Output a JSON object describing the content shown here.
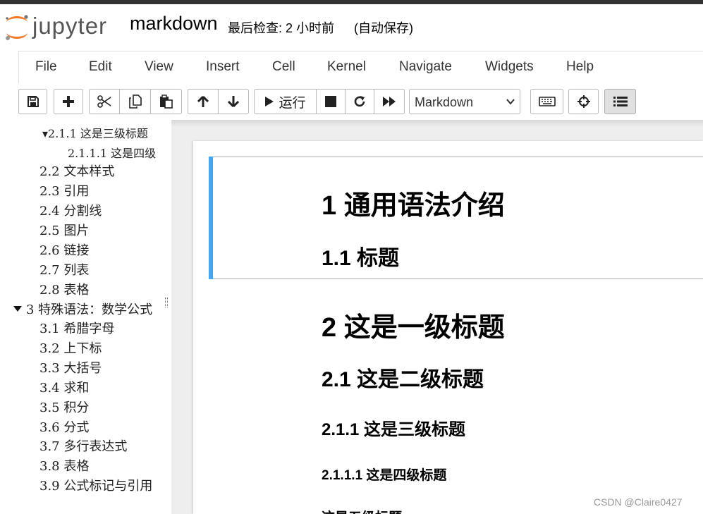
{
  "header": {
    "logo_text": "jupyter",
    "notebook_name": "markdown",
    "checkpoint": "最后检查: 2 小时前",
    "autosave": "(自动保存)"
  },
  "menubar": [
    "File",
    "Edit",
    "View",
    "Insert",
    "Cell",
    "Kernel",
    "Navigate",
    "Widgets",
    "Help"
  ],
  "toolbar": {
    "run_label": "运行",
    "cell_type": "Markdown"
  },
  "toc": [
    {
      "label": "▾2.1.1 这是三级标题"
    },
    {
      "label": "2.1.1.1 这是四级"
    },
    {
      "label": "2.2 文本样式"
    },
    {
      "label": "2.3 引用"
    },
    {
      "label": "2.4 分割线"
    },
    {
      "label": "2.5 图片"
    },
    {
      "label": "2.6 链接"
    },
    {
      "label": "2.7 列表"
    },
    {
      "label": "2.8 表格"
    },
    {
      "label": "3 特殊语法：数学公式"
    },
    {
      "label": "3.1 希腊字母"
    },
    {
      "label": "3.2 上下标"
    },
    {
      "label": "3.3 大括号"
    },
    {
      "label": "3.4 求和"
    },
    {
      "label": "3.5 积分"
    },
    {
      "label": "3.6 分式"
    },
    {
      "label": "3.7 多行表达式"
    },
    {
      "label": "3.8 表格"
    },
    {
      "label": "3.9 公式标记与引用"
    }
  ],
  "cells": [
    {
      "text": "1  通用语法介绍"
    },
    {
      "text": "1.1  标题"
    },
    {
      "text": "2  这是一级标题"
    },
    {
      "text": "2.1  这是二级标题"
    },
    {
      "text": "2.1.1  这是三级标题"
    },
    {
      "text": "2.1.1.1  这是四级标题"
    },
    {
      "text": "这是五级标题"
    }
  ],
  "watermark": "CSDN @Claire0427"
}
